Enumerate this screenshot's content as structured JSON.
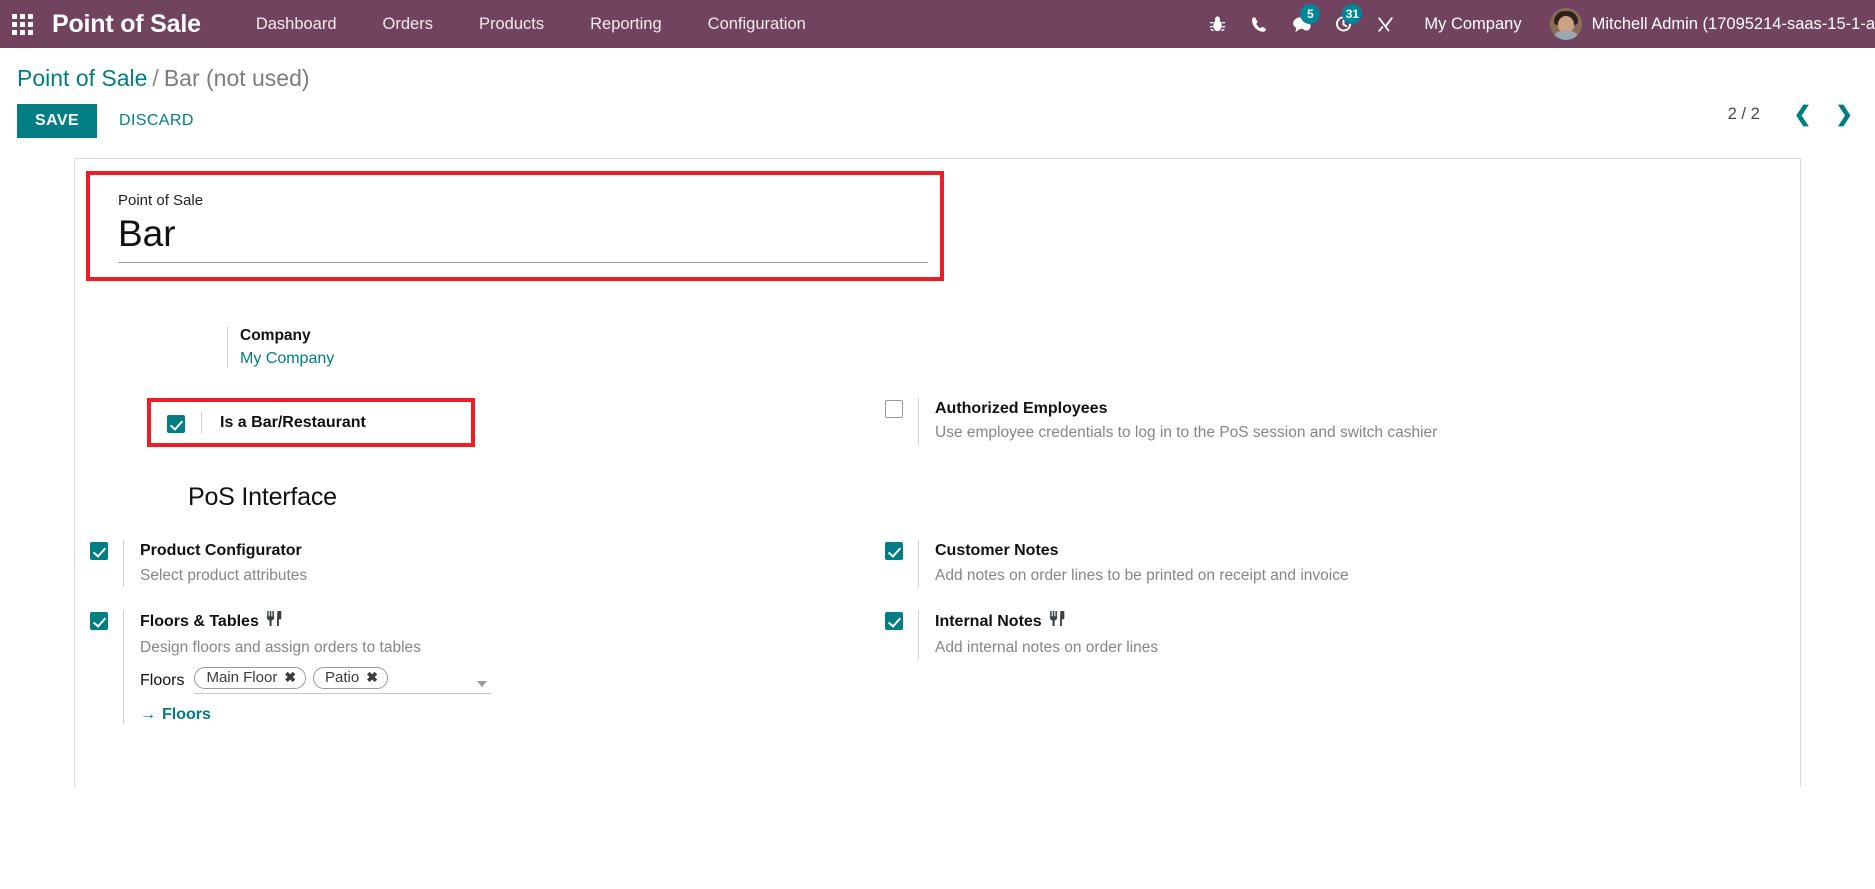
{
  "navbar": {
    "apps_icon": "apps-grid-icon",
    "brand": "Point of Sale",
    "menu": [
      {
        "label": "Dashboard"
      },
      {
        "label": "Orders"
      },
      {
        "label": "Products"
      },
      {
        "label": "Reporting"
      },
      {
        "label": "Configuration"
      }
    ],
    "sys_icons": [
      {
        "name": "bug-icon",
        "badge": null
      },
      {
        "name": "phone-icon",
        "badge": null
      },
      {
        "name": "messages-icon",
        "badge": "5"
      },
      {
        "name": "activities-clock-icon",
        "badge": "31"
      },
      {
        "name": "tools-icon",
        "badge": null
      }
    ],
    "company": "My Company",
    "user": "Mitchell Admin (17095214-saas-15-1-a",
    "avatar": "user-avatar"
  },
  "breadcrumb": {
    "root": "Point of Sale",
    "separator": "/",
    "current": "Bar (not used)"
  },
  "actions": {
    "save": "SAVE",
    "discard": "DISCARD"
  },
  "pager": {
    "count": "2 / 2",
    "prev_icon": "chevron-left-icon",
    "next_icon": "chevron-right-icon"
  },
  "form": {
    "title_label": "Point of Sale",
    "title_value": "Bar",
    "company": {
      "label": "Company",
      "value": "My Company"
    },
    "is_bar_restaurant": {
      "label": "Is a Bar/Restaurant",
      "checked": true
    },
    "authorized_employees": {
      "label": "Authorized Employees",
      "desc": "Use employee credentials to log in to the PoS session and switch cashier",
      "checked": false
    },
    "section_title": "PoS Interface",
    "left_settings": [
      {
        "label": "Product Configurator",
        "desc": "Select product attributes",
        "checked": true,
        "icon": null
      },
      {
        "label": "Floors & Tables",
        "desc": "Design floors and assign orders to tables",
        "checked": true,
        "icon": "restaurant-fork-knife-icon"
      }
    ],
    "right_settings": [
      {
        "label": "Customer Notes",
        "desc": "Add notes on order lines to be printed on receipt and invoice",
        "checked": true,
        "icon": null
      },
      {
        "label": "Internal Notes",
        "desc": "Add internal notes on order lines",
        "checked": true,
        "icon": "restaurant-fork-knife-icon"
      }
    ],
    "floors_field": {
      "label": "Floors",
      "tags": [
        "Main Floor",
        "Patio"
      ],
      "remove_glyph": "✖",
      "dropdown_icon": "chevron-down-icon"
    },
    "floors_link": {
      "arrow": "→",
      "label": "Floors"
    }
  },
  "colors": {
    "navbar": "#71435f",
    "accent": "#017e84",
    "badge": "#00859a",
    "highlight": "#ee1c25",
    "muted_text": "#84868a"
  }
}
